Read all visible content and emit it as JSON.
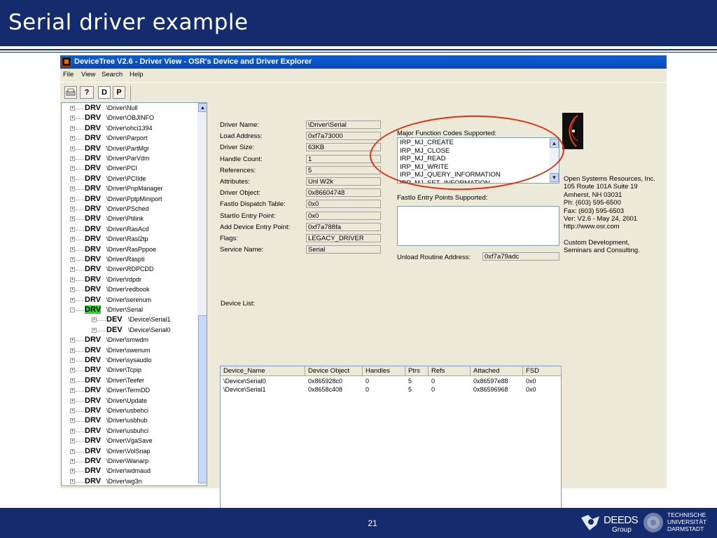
{
  "slide": {
    "title": "Serial driver example",
    "page_number": "21",
    "footer_logo_text": "DEEDS",
    "footer_logo_sub": "Group",
    "university_lines": [
      "TECHNISCHE",
      "UNIVERSITÄT",
      "DARMSTADT"
    ]
  },
  "window": {
    "title": "DeviceTree V2.6 - Driver View - OSR's Device and Driver Explorer",
    "menu": [
      "File",
      "View",
      "Search",
      "Help"
    ],
    "toolbar": {
      "print_icon": "printer-icon",
      "help_icon": "help-icon",
      "d_label": "D",
      "p_label": "P"
    }
  },
  "tree": {
    "items": [
      {
        "kind": "DRV",
        "path": "\\Driver\\Null",
        "expander": "+"
      },
      {
        "kind": "DRV",
        "path": "\\Driver\\OBJINFO",
        "expander": "+"
      },
      {
        "kind": "DRV",
        "path": "\\Driver\\ohci1394",
        "expander": "+"
      },
      {
        "kind": "DRV",
        "path": "\\Driver\\Parport",
        "expander": "+"
      },
      {
        "kind": "DRV",
        "path": "\\Driver\\PartMgr",
        "expander": "+"
      },
      {
        "kind": "DRV",
        "path": "\\Driver\\ParVdm",
        "expander": "+"
      },
      {
        "kind": "DRV",
        "path": "\\Driver\\PCI",
        "expander": "+"
      },
      {
        "kind": "DRV",
        "path": "\\Driver\\PCIIde",
        "expander": "+"
      },
      {
        "kind": "DRV",
        "path": "\\Driver\\PnpManager",
        "expander": "+"
      },
      {
        "kind": "DRV",
        "path": "\\Driver\\PptpMiniport",
        "expander": "+"
      },
      {
        "kind": "DRV",
        "path": "\\Driver\\PSched",
        "expander": "+"
      },
      {
        "kind": "DRV",
        "path": "\\Driver\\Ptilink",
        "expander": "+"
      },
      {
        "kind": "DRV",
        "path": "\\Driver\\RasAcd",
        "expander": "+"
      },
      {
        "kind": "DRV",
        "path": "\\Driver\\Rasl2tp",
        "expander": "+"
      },
      {
        "kind": "DRV",
        "path": "\\Driver\\RasPppoe",
        "expander": "+"
      },
      {
        "kind": "DRV",
        "path": "\\Driver\\Raspti",
        "expander": "+"
      },
      {
        "kind": "DRV",
        "path": "\\Driver\\RDPCDD",
        "expander": "+"
      },
      {
        "kind": "DRV",
        "path": "\\Driver\\rdpdr",
        "expander": "+"
      },
      {
        "kind": "DRV",
        "path": "\\Driver\\redbook",
        "expander": "+"
      },
      {
        "kind": "DRV",
        "path": "\\Driver\\serenum",
        "expander": "+"
      },
      {
        "kind": "DRV",
        "path": "\\Driver\\Serial",
        "expander": "-",
        "selected": true
      },
      {
        "kind": "DEV",
        "path": "\\Device\\Serial1",
        "expander": "+",
        "child": true
      },
      {
        "kind": "DEV",
        "path": "\\Device\\Serial0",
        "expander": "+",
        "child": true
      },
      {
        "kind": "DRV",
        "path": "\\Driver\\smwdm",
        "expander": "+"
      },
      {
        "kind": "DRV",
        "path": "\\Driver\\swenum",
        "expander": "+"
      },
      {
        "kind": "DRV",
        "path": "\\Driver\\sysaudio",
        "expander": "+"
      },
      {
        "kind": "DRV",
        "path": "\\Driver\\Tcpip",
        "expander": "+"
      },
      {
        "kind": "DRV",
        "path": "\\Driver\\Teefer",
        "expander": "+"
      },
      {
        "kind": "DRV",
        "path": "\\Driver\\TermDD",
        "expander": "+"
      },
      {
        "kind": "DRV",
        "path": "\\Driver\\Update",
        "expander": "+"
      },
      {
        "kind": "DRV",
        "path": "\\Driver\\usbehci",
        "expander": "+"
      },
      {
        "kind": "DRV",
        "path": "\\Driver\\usbhub",
        "expander": "+"
      },
      {
        "kind": "DRV",
        "path": "\\Driver\\usbuhci",
        "expander": "+"
      },
      {
        "kind": "DRV",
        "path": "\\Driver\\VgaSave",
        "expander": "+"
      },
      {
        "kind": "DRV",
        "path": "\\Driver\\VolSnap",
        "expander": "+"
      },
      {
        "kind": "DRV",
        "path": "\\Driver\\Wanarp",
        "expander": "+"
      },
      {
        "kind": "DRV",
        "path": "\\Driver\\wdmaud",
        "expander": "+"
      },
      {
        "kind": "DRV",
        "path": "\\Driver\\wg3n",
        "expander": "+"
      }
    ]
  },
  "fields": [
    {
      "label": "Driver Name:",
      "value": "\\Driver\\Serial"
    },
    {
      "label": "Load Address:",
      "value": "0xf7a73000"
    },
    {
      "label": "Driver Size:",
      "value": "63KB"
    },
    {
      "label": "Handle Count:",
      "value": "1"
    },
    {
      "label": "References:",
      "value": "5"
    },
    {
      "label": "Attributes:",
      "value": "Unl W2k"
    },
    {
      "label": "Driver Object:",
      "value": "0x86604748"
    },
    {
      "label": "FastIo Dispatch Table:",
      "value": "0x0"
    },
    {
      "label": "StartIo Entry Point:",
      "value": "0x0"
    },
    {
      "label": "Add Device Entry Point:",
      "value": "0xf7a788fa"
    },
    {
      "label": "Flags:",
      "value": "LEGACY_DRIVER"
    },
    {
      "label": "Service Name:",
      "value": "Serial"
    }
  ],
  "major_functions": {
    "label": "Major Function Codes Supported:",
    "items": [
      "IRP_MJ_CREATE",
      "IRP_MJ_CLOSE",
      "IRP_MJ_READ",
      "IRP_MJ_WRITE",
      "IRP_MJ_QUERY_INFORMATION",
      "IRP_MJ_SET_INFORMATION"
    ]
  },
  "fastio": {
    "label": "FastIo Entry Points Supported:"
  },
  "unload": {
    "label": "Unload Routine Address:",
    "value": "0xf7a79adc"
  },
  "about": {
    "lines": [
      "Open Systems Resources, Inc.",
      "105 Route 101A Suite 19",
      "Amherst, NH 03031",
      "Ph:  (603) 595-6500",
      "Fax: (603) 595-6503",
      "Ver: V2.6  -  May 24, 2001",
      "http://www.osr.com"
    ],
    "extra_lines": [
      "Custom Development,",
      "Seminars and Consulting."
    ]
  },
  "device_list": {
    "label": "Device List:",
    "columns": [
      "Device_Name",
      "Device Object",
      "Handles",
      "Ptrs",
      "Refs",
      "Attached",
      "FSD"
    ],
    "rows": [
      [
        "\\Device\\Serial0",
        "0x865928c0",
        "0",
        "5",
        "0",
        "0x86597e88",
        "0x0"
      ],
      [
        "\\Device\\Serial1",
        "0x8658c408",
        "0",
        "5",
        "0",
        "0x86596968",
        "0x0"
      ]
    ]
  },
  "colors": {
    "slide_blue": "#142b6e",
    "highlight_ellipse": "#e03010",
    "selected_node": "#22dd22"
  }
}
